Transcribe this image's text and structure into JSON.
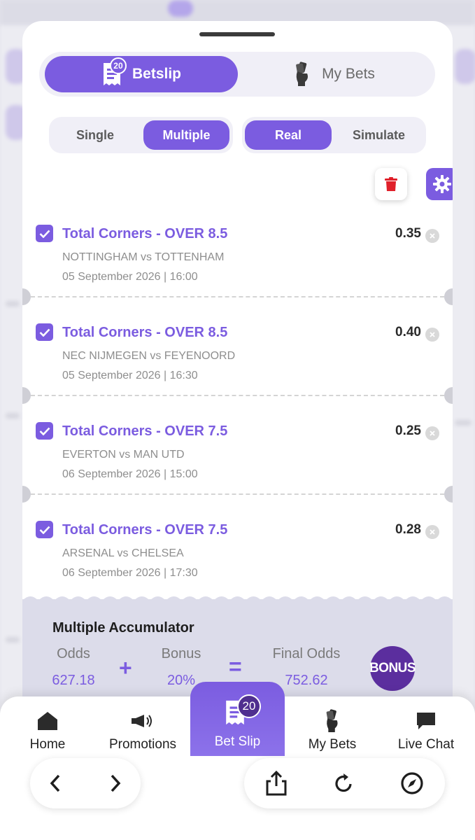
{
  "tabs": {
    "betslip": "Betslip",
    "my_bets": "My Bets",
    "badge": "20"
  },
  "mode": {
    "single": "Single",
    "multiple": "Multiple",
    "real": "Real",
    "simulate": "Simulate"
  },
  "bets": [
    {
      "market": "Total Corners - OVER 8.5",
      "teams": "NOTTINGHAM vs TOTTENHAM",
      "date": "05 September 2026 | 16:00",
      "odds": "0.35"
    },
    {
      "market": "Total Corners - OVER 8.5",
      "teams": "NEC NIJMEGEN vs FEYENOORD",
      "date": "05 September 2026 | 16:30",
      "odds": "0.40"
    },
    {
      "market": "Total Corners - OVER 7.5",
      "teams": "EVERTON vs MAN UTD",
      "date": "06 September 2026 | 15:00",
      "odds": "0.25"
    },
    {
      "market": "Total Corners - OVER 7.5",
      "teams": "ARSENAL vs CHELSEA",
      "date": "06 September 2026 | 17:30",
      "odds": "0.28"
    }
  ],
  "summary": {
    "title": "Multiple Accumulator",
    "odds_label": "Odds",
    "odds_value": "627.18",
    "bonus_label": "Bonus",
    "bonus_value": "20%",
    "final_label": "Final Odds",
    "final_value": "752.62",
    "plus": "+",
    "equals": "=",
    "bonus_badge": "BONUS"
  },
  "nav": {
    "home": "Home",
    "promotions": "Promotions",
    "bet_slip": "Bet Slip",
    "my_bets": "My Bets",
    "live_chat": "Live Chat",
    "badge": "20"
  },
  "colors": {
    "accent": "#7b5ce0",
    "accent_dark": "#5b2e9e",
    "delete": "#e0202a"
  },
  "icons": {
    "betslip_tab": "receipt-icon",
    "mybets_tab": "hand-cards-icon",
    "delete": "trash-icon",
    "settings": "gear-icon",
    "back": "chevron-left-icon",
    "forward": "chevron-right-icon",
    "share": "share-icon",
    "reload": "reload-icon",
    "browser": "compass-icon"
  }
}
